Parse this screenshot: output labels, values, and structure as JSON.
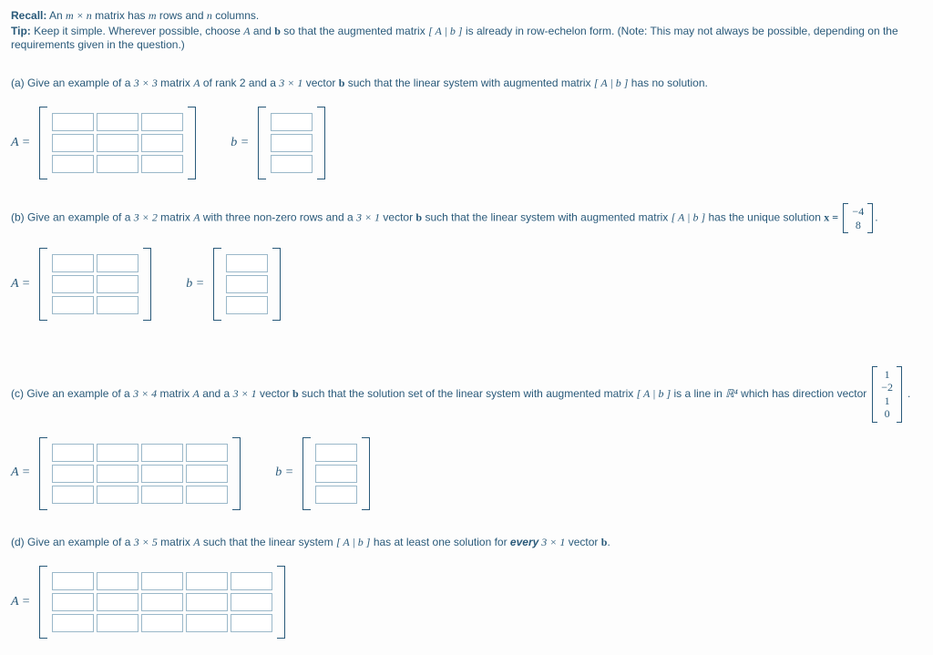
{
  "header": {
    "recall_label": "Recall:",
    "recall_text_1": "An ",
    "recall_mn": "m × n",
    "recall_text_2": " matrix has ",
    "recall_m": "m",
    "recall_text_3": " rows and ",
    "recall_n": "n",
    "recall_text_4": " columns.",
    "tip_label": "Tip:",
    "tip_text_1": " Keep it simple. Wherever possible, choose ",
    "tip_A": "A",
    "tip_text_2": " and ",
    "tip_b": "b",
    "tip_text_3": " so that the augmented matrix ",
    "tip_aug": "[ A | b ]",
    "tip_text_4": " is already in row-echelon form.   (Note: This may not always be possible, depending on the requirements given in the question.)"
  },
  "parts": {
    "a": {
      "label": "(a) Give an example of a ",
      "dim": "3 × 3",
      "t1": " matrix ",
      "A": "A",
      "t2": " of rank 2 and a ",
      "vdim": "3 × 1",
      "t3": " vector ",
      "b": "b",
      "t4": " such that the linear system with augmented matrix ",
      "aug": "[ A | b ]",
      "t5": " has no solution.",
      "eqA": "A =",
      "eqb": "b ="
    },
    "b": {
      "label": "(b) Give an example of a ",
      "dim": "3 × 2",
      "t1": " matrix ",
      "A": "A",
      "t2": " with three non-zero rows and a ",
      "vdim": "3 × 1",
      "t3": " vector ",
      "b": "b",
      "t4": " such that the linear system with augmented matrix ",
      "aug": "[ A | b ]",
      "t5": " has the unique solution ",
      "x": "x =",
      "sol": [
        "−4",
        "8"
      ],
      "period": ".",
      "eqA": "A =",
      "eqb": "b ="
    },
    "c": {
      "label": "(c) Give an example of a ",
      "dim": "3 × 4",
      "t1": " matrix ",
      "A": "A",
      "t2": " and a ",
      "vdim": "3 × 1",
      "t3": " vector ",
      "b": "b",
      "t4": " such that the solution set of the linear system with augmented matrix ",
      "aug": "[ A | b ]",
      "t5": " is a line in ",
      "R4": "ℝ⁴",
      "t6": " which has direction vector ",
      "dir": [
        "1",
        "−2",
        "1",
        "0"
      ],
      "period": ".",
      "eqA": "A =",
      "eqb": "b ="
    },
    "d": {
      "label": "(d) Give an example of a ",
      "dim": "3 × 5",
      "t1": " matrix ",
      "A": "A",
      "t2": " such that the linear system ",
      "aug": "[ A | b ]",
      "t3": " has at least one solution for ",
      "every": "every",
      "vdim": " 3 × 1",
      "t4": " vector ",
      "b": "b",
      "period": ".",
      "eqA": "A ="
    }
  },
  "matrices": {
    "a_A": {
      "rows": 3,
      "cols": 3
    },
    "a_b": {
      "rows": 3,
      "cols": 1
    },
    "b_A": {
      "rows": 3,
      "cols": 2
    },
    "b_b": {
      "rows": 3,
      "cols": 1
    },
    "c_A": {
      "rows": 3,
      "cols": 4
    },
    "c_b": {
      "rows": 3,
      "cols": 1
    },
    "d_A": {
      "rows": 3,
      "cols": 5
    }
  }
}
